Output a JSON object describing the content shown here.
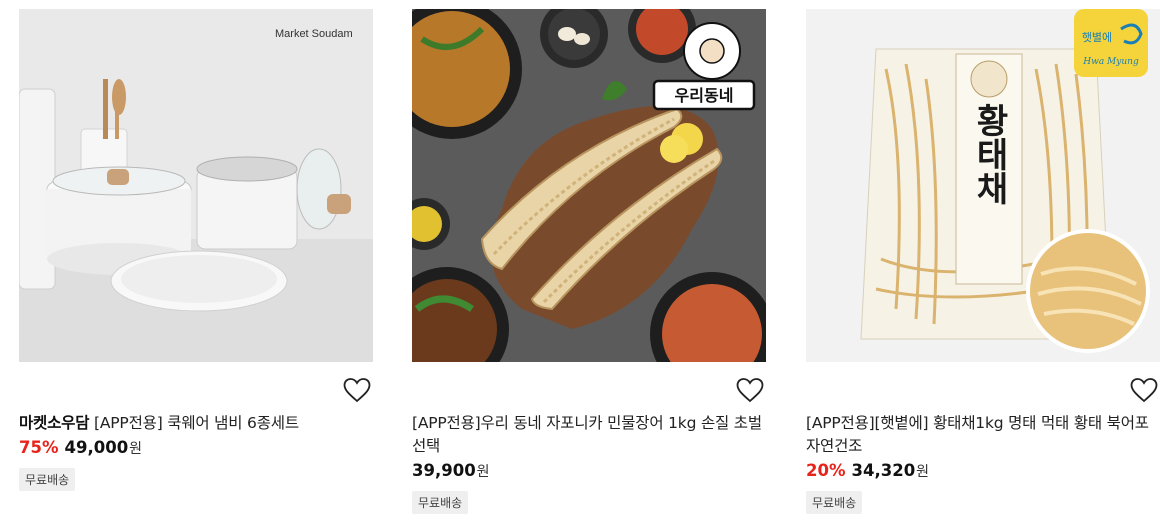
{
  "products": [
    {
      "image_caption": "Market Soudam",
      "brand": "마켓소우담",
      "title": " [APP전용] 쿡웨어 냄비 6종세트",
      "discount": "75%",
      "price": "49,000",
      "currency": "원",
      "badge": "무료배송",
      "wishlist_icon": "heart-outline-icon"
    },
    {
      "image_caption": "우리동네",
      "brand": "",
      "title": "[APP전용]우리 동네 자포니카 민물장어 1kg 손질 초벌 선택",
      "discount": "",
      "price": "39,900",
      "currency": "원",
      "badge": "무료배송",
      "wishlist_icon": "heart-outline-icon"
    },
    {
      "image_caption": "황태채",
      "image_logo": "햇별에",
      "image_logo_sub": "Hwa Myung",
      "brand": "",
      "title": "[APP전용][햇볕에] 황태채1kg 명태 먹태 황태 북어포 자연건조",
      "discount": "20%",
      "price": "34,320",
      "currency": "원",
      "badge": "무료배송",
      "wishlist_icon": "heart-outline-icon"
    }
  ]
}
